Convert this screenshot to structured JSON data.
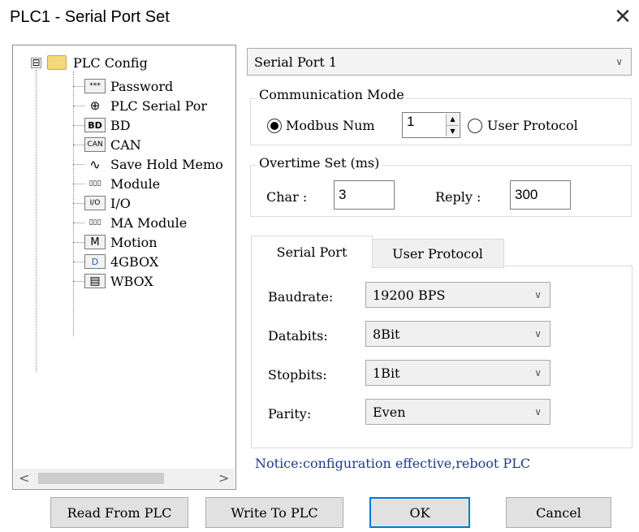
{
  "window": {
    "title": "PLC1 - Serial Port Set",
    "close_glyph": "✕"
  },
  "tree": {
    "expander": "⊟",
    "root": "PLC Config",
    "items": [
      {
        "label": "Password",
        "icon": "password-icon",
        "icon_text": "***"
      },
      {
        "label": "PLC Serial Por",
        "icon": "serial-port-icon",
        "icon_text": "⊕"
      },
      {
        "label": "BD",
        "icon": "bd-icon",
        "icon_text": "BD"
      },
      {
        "label": "CAN",
        "icon": "can-icon",
        "icon_text": "CAN"
      },
      {
        "label": "Save Hold Memo",
        "icon": "save-hold-memory-icon",
        "icon_text": "∿"
      },
      {
        "label": "Module",
        "icon": "module-icon",
        "icon_text": "▯▯▯"
      },
      {
        "label": "I/O",
        "icon": "io-icon",
        "icon_text": "I/O"
      },
      {
        "label": "MA Module",
        "icon": "ma-module-icon",
        "icon_text": "▯▯▯"
      },
      {
        "label": "Motion",
        "icon": "motion-icon",
        "icon_text": "M"
      },
      {
        "label": "4GBOX",
        "icon": "4gbox-icon",
        "icon_text": "D"
      },
      {
        "label": "WBOX",
        "icon": "wbox-icon",
        "icon_text": "▤"
      }
    ],
    "scroll_left": "<",
    "scroll_right": ">"
  },
  "port_select": {
    "value": "Serial Port 1",
    "arrow": "∨"
  },
  "comm_mode": {
    "title": "Communication Mode",
    "modbus_label": "Modbus Num",
    "modbus_value": "1",
    "user_protocol_label": "User Protocol",
    "selected": "modbus"
  },
  "overtime": {
    "title": "Overtime Set (ms)",
    "char_label": "Char :",
    "char_value": "3",
    "reply_label": "Reply :",
    "reply_value": "300"
  },
  "tabs": [
    {
      "label": "Serial Port",
      "active": true
    },
    {
      "label": "User Protocol",
      "active": false
    }
  ],
  "serial": {
    "baudrate_label": "Baudrate:",
    "baudrate_value": "19200 BPS",
    "databits_label": "Databits:",
    "databits_value": "8Bit",
    "stopbits_label": "Stopbits:",
    "stopbits_value": "1Bit",
    "parity_label": "Parity:",
    "parity_value": "Even"
  },
  "notice": "Notice:configuration effective,reboot PLC",
  "buttons": {
    "read": "Read From PLC",
    "write": "Write To PLC",
    "ok": "OK",
    "cancel": "Cancel"
  },
  "colors": {
    "accent": "#0078d7",
    "notice": "#1f3a8a",
    "folder": "#f5d87a"
  }
}
